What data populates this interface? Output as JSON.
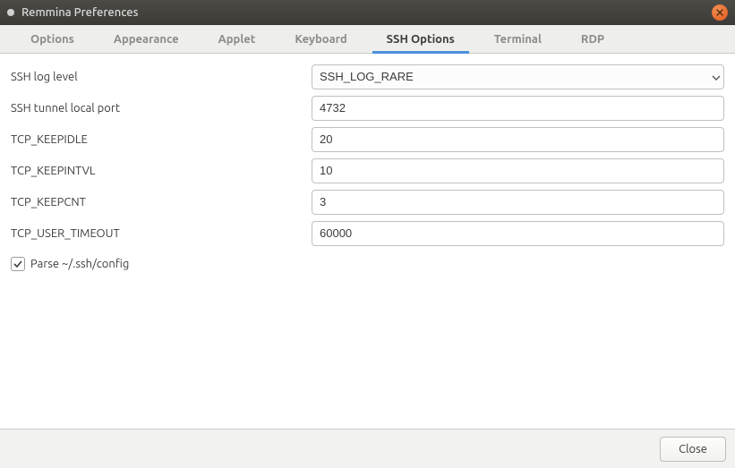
{
  "window": {
    "title": "Remmina Preferences"
  },
  "tabs": [
    {
      "label": "Options"
    },
    {
      "label": "Appearance"
    },
    {
      "label": "Applet"
    },
    {
      "label": "Keyboard"
    },
    {
      "label": "SSH Options"
    },
    {
      "label": "Terminal"
    },
    {
      "label": "RDP"
    }
  ],
  "fields": {
    "ssh_log_level": {
      "label": "SSH log level",
      "value": "SSH_LOG_RARE"
    },
    "ssh_tunnel_port": {
      "label": "SSH tunnel local port",
      "value": "4732"
    },
    "tcp_keepidle": {
      "label": "TCP_KEEPIDLE",
      "value": "20"
    },
    "tcp_keepintvl": {
      "label": "TCP_KEEPINTVL",
      "value": "10"
    },
    "tcp_keepcnt": {
      "label": "TCP_KEEPCNT",
      "value": "3"
    },
    "tcp_user_timeout": {
      "label": "TCP_USER_TIMEOUT",
      "value": "60000"
    },
    "parse_ssh_config": {
      "label": "Parse ~/.ssh/config",
      "checked": true
    }
  },
  "buttons": {
    "close": "Close"
  }
}
